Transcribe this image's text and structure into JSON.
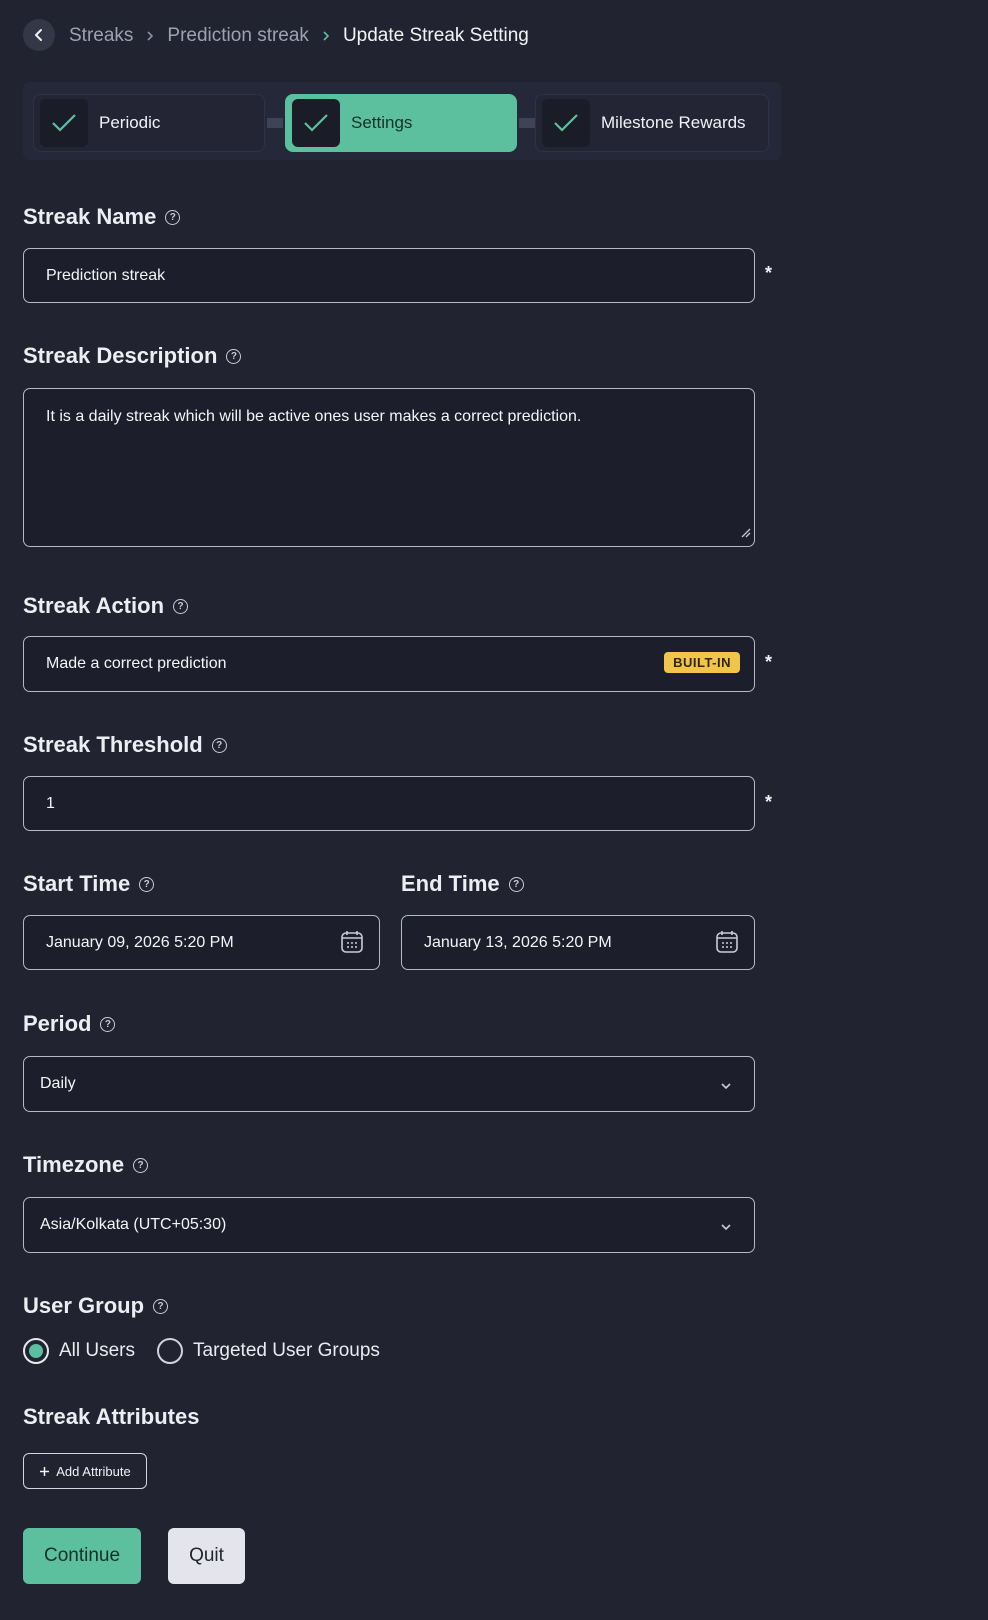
{
  "breadcrumb": {
    "items": [
      "Streaks",
      "Prediction streak"
    ],
    "current": "Update Streak Setting"
  },
  "stepper": {
    "steps": [
      {
        "label": "Periodic",
        "active": false
      },
      {
        "label": "Settings",
        "active": true
      },
      {
        "label": "Milestone Rewards",
        "active": false
      }
    ]
  },
  "fields": {
    "streak_name": {
      "label": "Streak Name",
      "value": "Prediction streak",
      "required_mark": "*"
    },
    "streak_description": {
      "label": "Streak Description",
      "value": "It is a daily streak which will be active ones user makes a correct prediction."
    },
    "streak_action": {
      "label": "Streak Action",
      "value": "Made a correct prediction",
      "badge": "BUILT-IN",
      "required_mark": "*"
    },
    "streak_threshold": {
      "label": "Streak Threshold",
      "value": "1",
      "required_mark": "*"
    },
    "start_time": {
      "label": "Start Time",
      "value": "January 09, 2026 5:20 PM"
    },
    "end_time": {
      "label": "End Time",
      "value": "January 13, 2026 5:20 PM"
    },
    "period": {
      "label": "Period",
      "value": "Daily"
    },
    "timezone": {
      "label": "Timezone",
      "value": "Asia/Kolkata (UTC+05:30)"
    },
    "user_group": {
      "label": "User Group",
      "options": [
        {
          "label": "All Users",
          "selected": true
        },
        {
          "label": "Targeted User Groups",
          "selected": false
        }
      ]
    }
  },
  "attributes": {
    "title": "Streak Attributes",
    "add_label": "Add Attribute"
  },
  "actions": {
    "continue_label": "Continue",
    "quit_label": "Quit"
  },
  "colors": {
    "accent": "#5cbf9e",
    "background": "#212331",
    "badge": "#f0c54a"
  }
}
